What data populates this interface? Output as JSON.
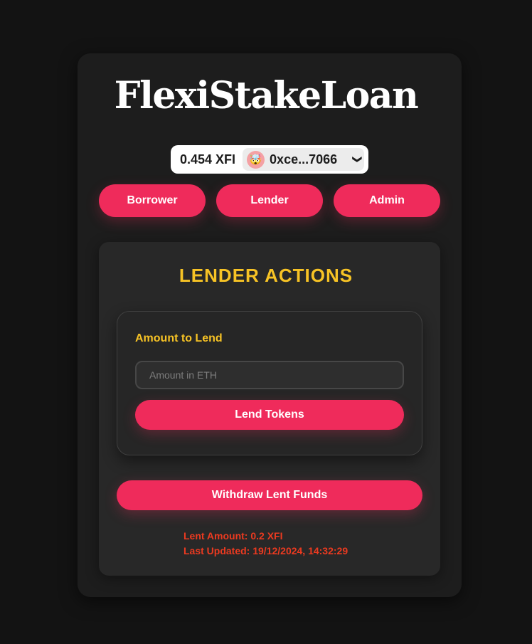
{
  "app": {
    "title": "FlexiStakeLoan"
  },
  "wallet": {
    "balance": "0.454 XFI",
    "avatar_emoji": "🤯",
    "address": "0xce...7066",
    "chevron": "❯"
  },
  "nav": {
    "borrower": "Borrower",
    "lender": "Lender",
    "admin": "Admin"
  },
  "lender_panel": {
    "title": "LENDER ACTIONS",
    "amount_label": "Amount to Lend",
    "amount_placeholder": "Amount in ETH",
    "amount_value": "",
    "lend_button": "Lend Tokens",
    "withdraw_button": "Withdraw Lent Funds",
    "lent_amount": "Lent Amount: 0.2 XFI",
    "last_updated": "Last Updated: 19/12/2024, 14:32:29"
  },
  "colors": {
    "accent": "#ef2b5b",
    "heading": "#f7c325",
    "status": "#ec3a20",
    "background": "#131313",
    "card": "#1d1d1d"
  }
}
